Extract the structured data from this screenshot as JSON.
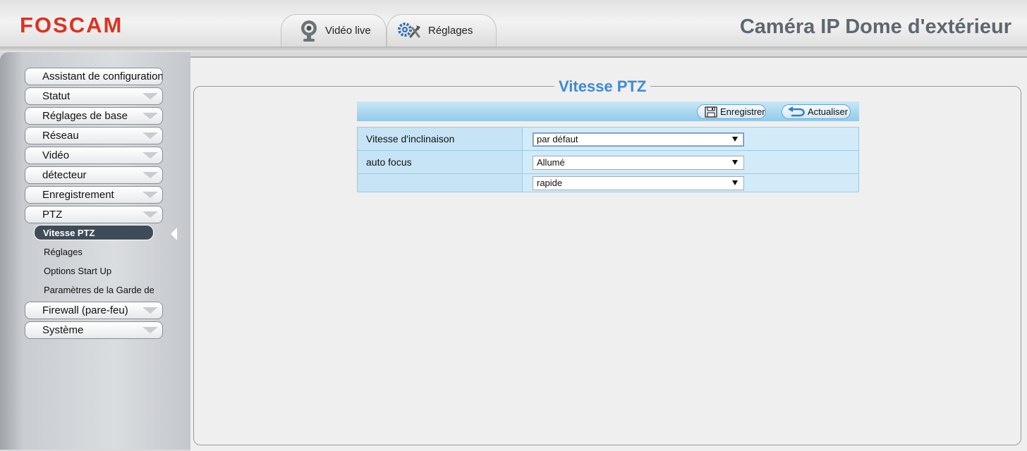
{
  "header": {
    "logo": "FOSCAM",
    "device_title": "Caméra IP Dome d'extérieur",
    "brand_color": "#e0311f",
    "tabs": [
      {
        "label": "Vidéo live",
        "icon": "webcam-icon"
      },
      {
        "label": "Réglages",
        "icon": "gears-icon"
      }
    ]
  },
  "sidebar": {
    "items": [
      {
        "label": "Assistant de configuration"
      },
      {
        "label": "Statut"
      },
      {
        "label": "Réglages de base"
      },
      {
        "label": "Réseau"
      },
      {
        "label": "Vidéo"
      },
      {
        "label": "détecteur"
      },
      {
        "label": "Enregistrement"
      },
      {
        "label": "PTZ"
      },
      {
        "label": "Firewall (pare-feu)"
      },
      {
        "label": "Système"
      }
    ],
    "ptz_subitems": [
      {
        "label": "Vitesse PTZ",
        "active": true
      },
      {
        "label": "Réglages"
      },
      {
        "label": "Options Start Up"
      },
      {
        "label": "Paramètres de la Garde de"
      }
    ]
  },
  "main": {
    "section_title": "Vitesse PTZ",
    "accent_color": "#3c8ad8",
    "toolbar": {
      "save_label": "Enregistrer",
      "refresh_label": "Actualiser"
    },
    "rows": [
      {
        "label": "Vitesse d'inclinaison",
        "value": "par défaut"
      },
      {
        "label": "auto focus",
        "value": "Allumé"
      },
      {
        "label": "",
        "value": "rapide"
      }
    ]
  }
}
